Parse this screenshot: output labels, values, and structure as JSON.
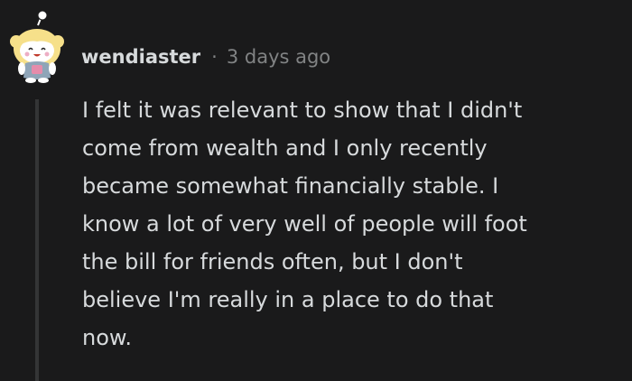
{
  "comment": {
    "author": "wendiaster",
    "separator": "·",
    "timestamp": "3 days ago",
    "body_lines": [
      "I felt it was relevant to show that I didn't",
      "come from wealth and I only recently",
      "became somewhat financially stable. I",
      "know a lot of very well of people will foot",
      "the bill for friends often, but I don't",
      "believe I'm really in a place to do that",
      "now."
    ]
  },
  "avatar": {
    "icon": "snoo-avatar-icon",
    "hair_color": "#f6e08a",
    "outfit_color": "#8fa5b8",
    "accent_color": "#e58cab"
  },
  "colors": {
    "background": "#1a1a1b",
    "text": "#d7dadc",
    "meta": "#818384",
    "thread_line": "#343536"
  }
}
